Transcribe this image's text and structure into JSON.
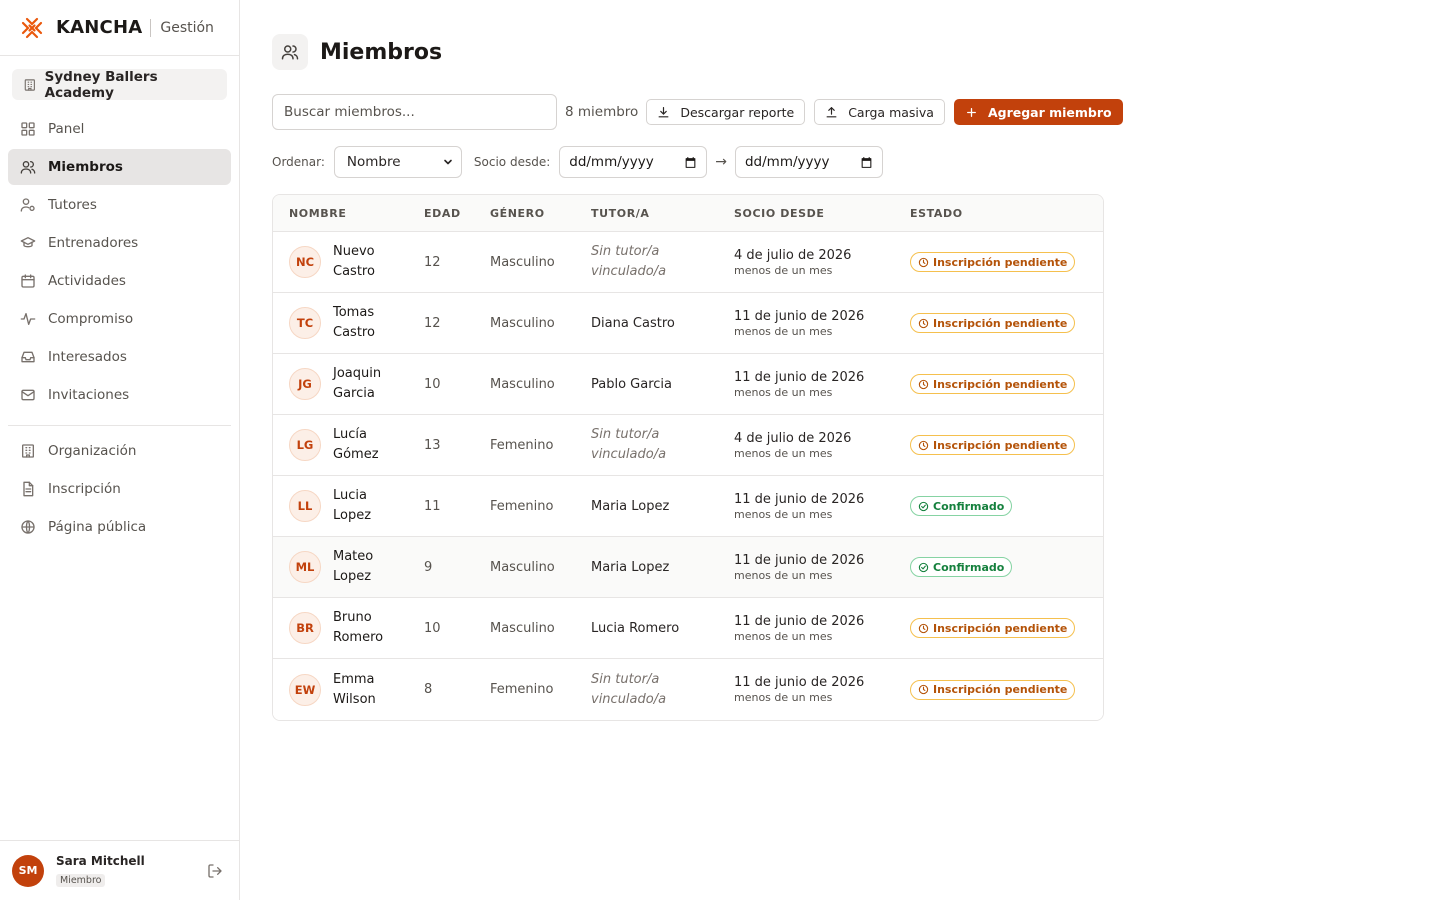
{
  "brand": {
    "name": "KANCHA",
    "subtitle": "Gestión"
  },
  "org": {
    "name": "Sydney Ballers Academy"
  },
  "sidebar": {
    "items": [
      {
        "label": "Panel",
        "icon": "panel-icon"
      },
      {
        "label": "Miembros",
        "icon": "users-icon",
        "active": true
      },
      {
        "label": "Tutores",
        "icon": "tutor-icon"
      },
      {
        "label": "Entrenadores",
        "icon": "graduation-cap-icon"
      },
      {
        "label": "Actividades",
        "icon": "calendar-icon"
      },
      {
        "label": "Compromiso",
        "icon": "activity-icon"
      },
      {
        "label": "Interesados",
        "icon": "inbox-icon"
      },
      {
        "label": "Invitaciones",
        "icon": "mail-icon"
      }
    ],
    "secondary": [
      {
        "label": "Organización",
        "icon": "building-icon"
      },
      {
        "label": "Inscripción",
        "icon": "file-icon"
      },
      {
        "label": "Página pública",
        "icon": "globe-icon"
      }
    ]
  },
  "user": {
    "initials": "SM",
    "name": "Sara Mitchell",
    "role": "Miembro"
  },
  "page": {
    "title": "Miembros"
  },
  "toolbar": {
    "search_placeholder": "Buscar miembros...",
    "count": "8 miembro",
    "download_label": "Descargar reporte",
    "bulk_label": "Carga masiva",
    "add_label": "Agregar miembro"
  },
  "filters": {
    "sort_label": "Ordenar:",
    "sort_value": "Nombre",
    "since_label": "Socio desde:",
    "from_placeholder": "dd/mm/yyyy",
    "arrow": "→",
    "to_placeholder": "dd/mm/yyyy"
  },
  "table": {
    "headers": [
      "NOMBRE",
      "EDAD",
      "GÉNERO",
      "TUTOR/A",
      "SOCIO DESDE",
      "ESTADO"
    ],
    "rows": [
      {
        "initials": "NC",
        "name": "Nuevo Castro",
        "age": "12",
        "gender": "Masculino",
        "tutor": "Sin tutor/a vinculado/a",
        "tutor_none": true,
        "since": "4 de julio de 2026",
        "since_rel": "menos de un mes",
        "status": "Inscripción pendiente",
        "status_type": "pending"
      },
      {
        "initials": "TC",
        "name": "Tomas Castro",
        "age": "12",
        "gender": "Masculino",
        "tutor": "Diana Castro",
        "tutor_none": false,
        "since": "11 de junio de 2026",
        "since_rel": "menos de un mes",
        "status": "Inscripción pendiente",
        "status_type": "pending"
      },
      {
        "initials": "JG",
        "name": "Joaquin Garcia",
        "age": "10",
        "gender": "Masculino",
        "tutor": "Pablo Garcia",
        "tutor_none": false,
        "since": "11 de junio de 2026",
        "since_rel": "menos de un mes",
        "status": "Inscripción pendiente",
        "status_type": "pending"
      },
      {
        "initials": "LG",
        "name": "Lucía Gómez",
        "age": "13",
        "gender": "Femenino",
        "tutor": "Sin tutor/a vinculado/a",
        "tutor_none": true,
        "since": "4 de julio de 2026",
        "since_rel": "menos de un mes",
        "status": "Inscripción pendiente",
        "status_type": "pending"
      },
      {
        "initials": "LL",
        "name": "Lucia Lopez",
        "age": "11",
        "gender": "Femenino",
        "tutor": "Maria Lopez",
        "tutor_none": false,
        "since": "11 de junio de 2026",
        "since_rel": "menos de un mes",
        "status": "Confirmado",
        "status_type": "ok"
      },
      {
        "initials": "ML",
        "name": "Mateo Lopez",
        "age": "9",
        "gender": "Masculino",
        "tutor": "Maria Lopez",
        "tutor_none": false,
        "since": "11 de junio de 2026",
        "since_rel": "menos de un mes",
        "status": "Confirmado",
        "status_type": "ok"
      },
      {
        "initials": "BR",
        "name": "Bruno Romero",
        "age": "10",
        "gender": "Masculino",
        "tutor": "Lucia Romero",
        "tutor_none": false,
        "since": "11 de junio de 2026",
        "since_rel": "menos de un mes",
        "status": "Inscripción pendiente",
        "status_type": "pending"
      },
      {
        "initials": "EW",
        "name": "Emma Wilson",
        "age": "8",
        "gender": "Femenino",
        "tutor": "Sin tutor/a vinculado/a",
        "tutor_none": true,
        "since": "11 de junio de 2026",
        "since_rel": "menos de un mes",
        "status": "Inscripción pendiente",
        "status_type": "pending"
      }
    ]
  },
  "colors": {
    "accent": "#c2410c",
    "pending": "#b45309",
    "confirmed": "#15803d",
    "active_nav_bg": "#e7e5e4"
  }
}
